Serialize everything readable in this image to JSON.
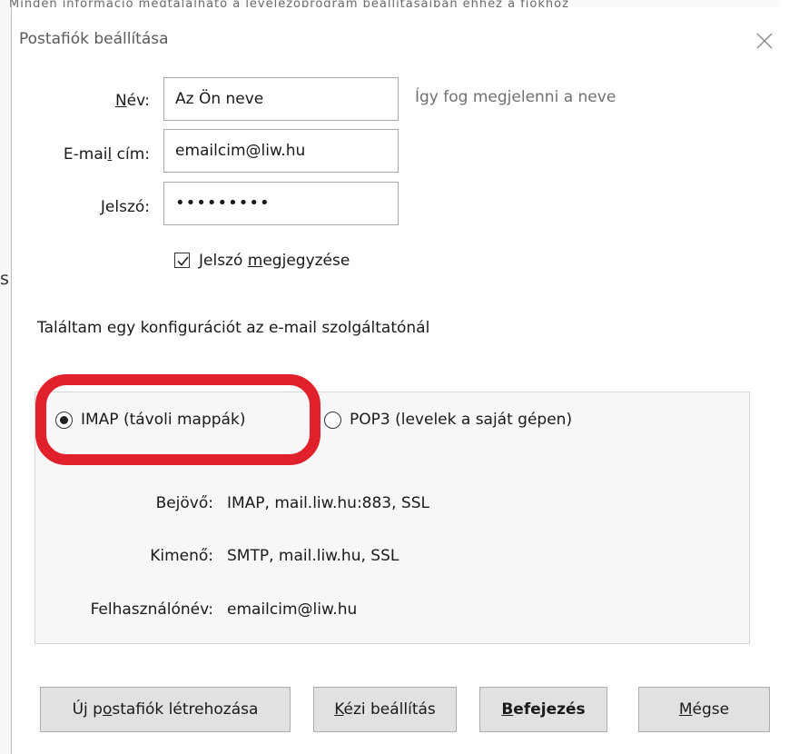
{
  "dialog": {
    "title": "Postafiók beállítása"
  },
  "form": {
    "name_label_pre": "",
    "name_label_u": "N",
    "name_label_post": "év:",
    "name_value": "Az Ön neve",
    "name_hint": "Így fog megjelenni a neve",
    "email_label_pre": "E-mai",
    "email_label_u": "l",
    "email_label_post": " cím:",
    "email_value": "emailcim@liw.hu",
    "password_label_pre": "",
    "password_label_u": "J",
    "password_label_post": "elszó:",
    "password_value": "•••••••••",
    "remember_pre": "Jelszó ",
    "remember_u": "m",
    "remember_post": "egjegyzése",
    "remember_checked": true
  },
  "config": {
    "found_text": "Találtam egy konfigurációt az e-mail szolgáltatónál",
    "imap_label": "IMAP (távoli mappák)",
    "pop3_label": "POP3 (levelek a saját gépen)",
    "selected": "imap",
    "incoming_label": "Bejövő:",
    "incoming_value": "IMAP, mail.liw.hu:883, SSL",
    "outgoing_label": "Kimenő:",
    "outgoing_value": "SMTP, mail.liw.hu, SSL",
    "username_label": "Felhasználónév:",
    "username_value": "emailcim@liw.hu"
  },
  "buttons": {
    "new_account_pre": "Új p",
    "new_account_u": "o",
    "new_account_post": "stafiók létrehozása",
    "manual_pre": "",
    "manual_u": "K",
    "manual_post": "ézi beállítás",
    "finish_pre": "",
    "finish_u": "B",
    "finish_post": "efejezés",
    "cancel_pre": "",
    "cancel_u": "M",
    "cancel_post": "égse"
  },
  "colors": {
    "highlight": "#e0202a",
    "button_bg": "#e1e1e1",
    "panel_bg": "#f7f7f7"
  },
  "background": {
    "partial_text": "Minden információ megtalálható a levelezőprogram beállításaiban ehhez a fiókhoz",
    "partial_char": "s"
  }
}
